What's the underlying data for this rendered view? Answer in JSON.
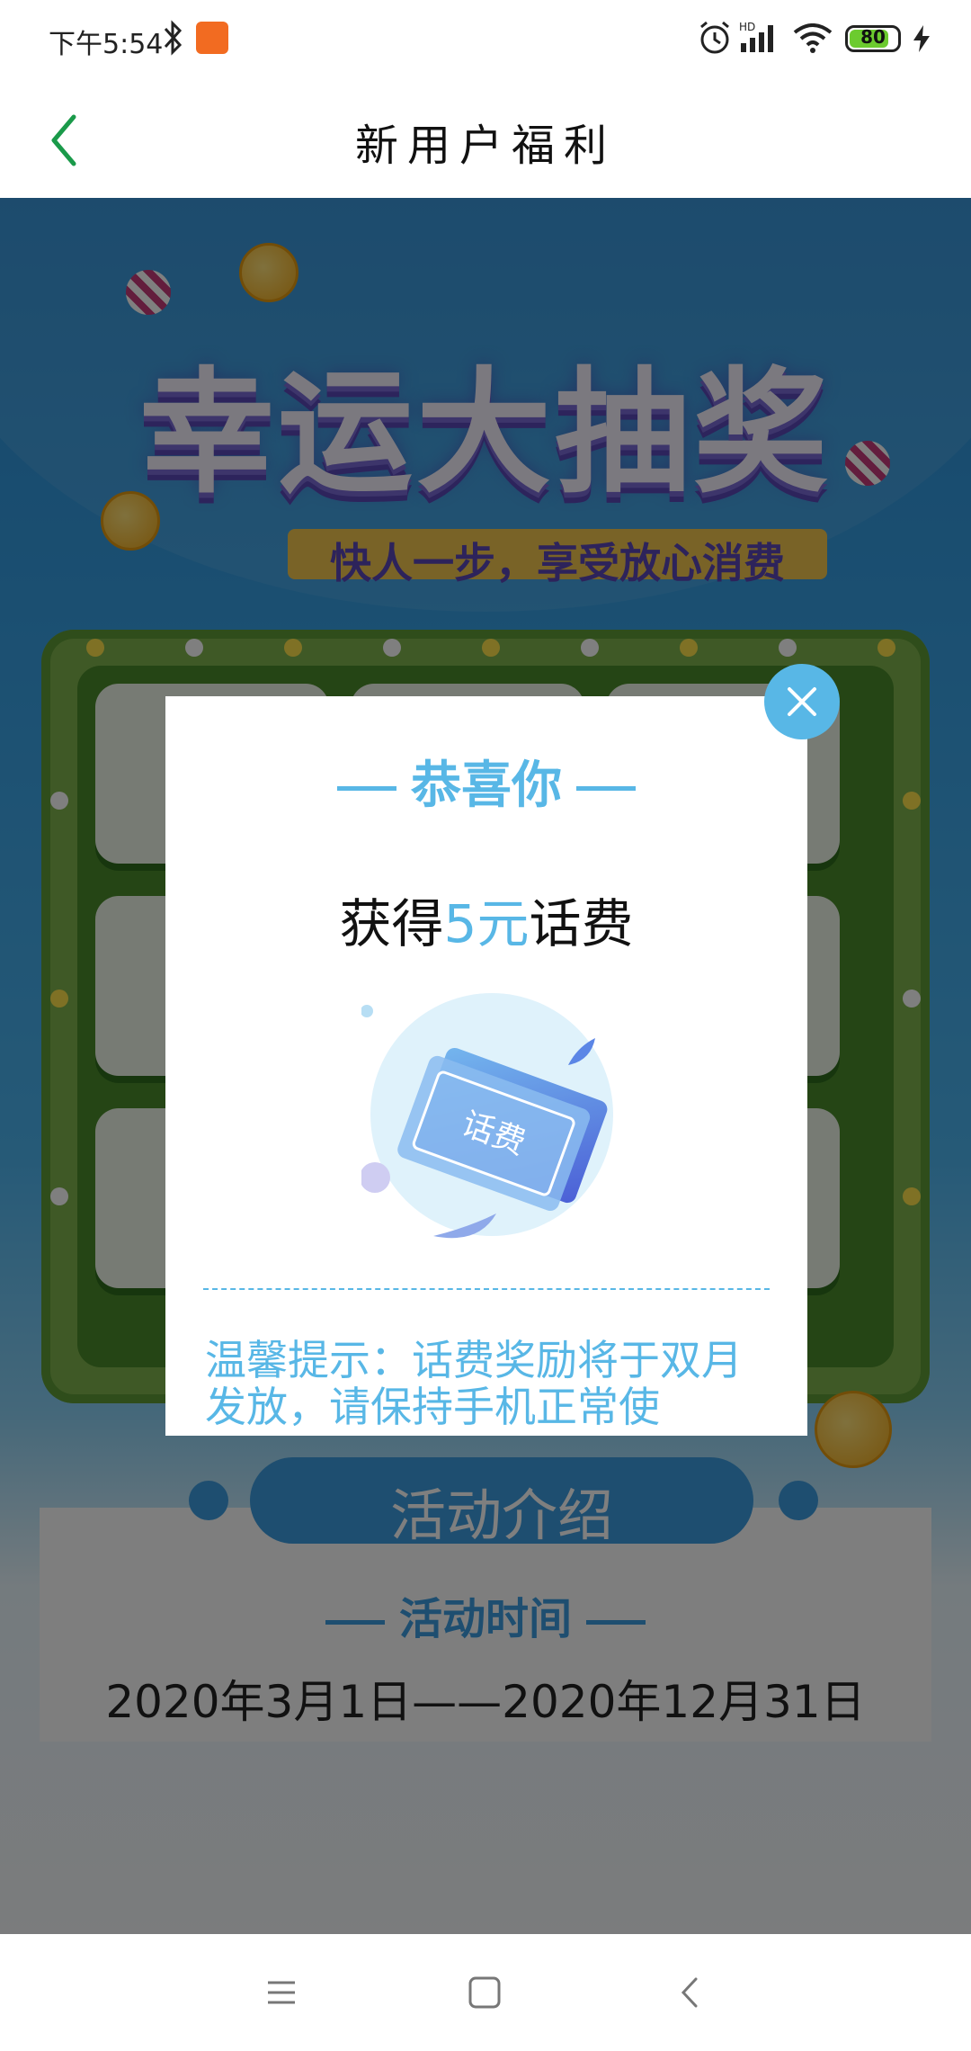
{
  "status_bar": {
    "time": "下午5:54",
    "battery": "80",
    "battery_level": 0.8,
    "icons": [
      "bluetooth-icon",
      "app-notification-icon",
      "alarm-icon",
      "hd-signal-icon",
      "wifi-icon",
      "battery-icon",
      "charging-icon"
    ]
  },
  "header": {
    "title": "新用户福利",
    "back_icon": "chevron-left-icon"
  },
  "banner": {
    "title": "幸运大抽奖",
    "subtitle": "快人一步，享受放心消费"
  },
  "modal": {
    "heading": "恭喜你",
    "prize_prefix": "获得",
    "prize_value": "5元",
    "prize_suffix": "话费",
    "voucher_label": "话费",
    "tip": "温馨提示：话费奖励将于双月发放，请保持手机正常使",
    "close_icon": "close-icon"
  },
  "activity": {
    "section_title": "活动介绍",
    "time_heading": "活动时间",
    "date_range": "2020年3月1日——2020年12月31日"
  },
  "nav_bar": {
    "icons": [
      "menu-icon",
      "home-icon",
      "back-icon"
    ]
  },
  "colors": {
    "accent": "#58b7e6",
    "brand_green": "#1a9a4a",
    "board_green": "#7fb24d"
  }
}
